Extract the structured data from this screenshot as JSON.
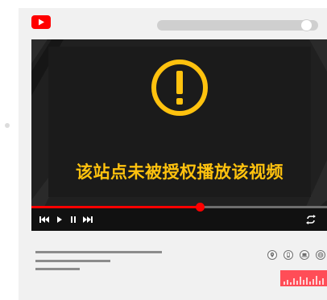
{
  "header": {
    "logo_icon": "play-logo-icon",
    "search_bar": "search-bar"
  },
  "player": {
    "message": "该站点未被授权播放该视频",
    "warning_icon": "exclamation-circle-icon",
    "accent_color": "#ffc20e",
    "progress_fraction": 0.57,
    "controls": [
      "skip-back-icon",
      "play-icon",
      "pause-icon",
      "skip-forward-icon",
      "repeat-icon"
    ]
  },
  "share_icons": [
    "location-pin-icon",
    "phone-icon",
    "laptop-icon",
    "globe-icon"
  ],
  "colors": {
    "brand_red": "#ff0000",
    "progress_red": "#ff0000",
    "equalizer_red": "#ff4d57"
  }
}
